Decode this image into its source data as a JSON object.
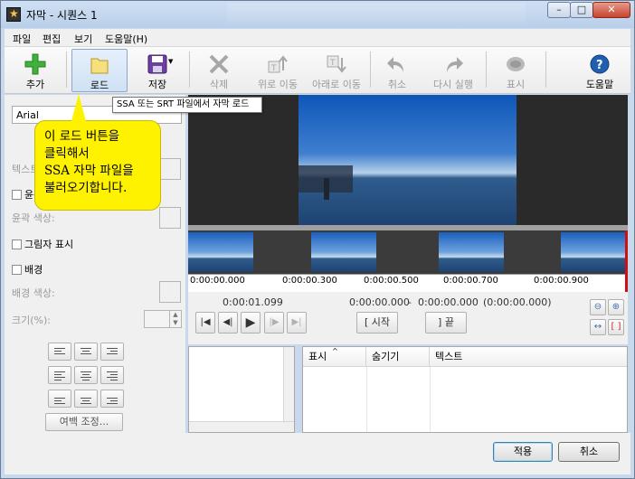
{
  "window": {
    "title": "자막 - 시퀀스 1",
    "controls": [
      "–",
      "□",
      "✕"
    ]
  },
  "menu": [
    "파일",
    "편집",
    "보기",
    "도움말(H)"
  ],
  "toolbar": {
    "add": "추가",
    "load": "로드",
    "save": "저장",
    "delete": "삭제",
    "move_up": "위로 이동",
    "move_down": "아래로 이동",
    "undo": "취소",
    "redo": "다시 실행",
    "show": "표시",
    "help": "도움말"
  },
  "tooltip": "SSA 또는 SRT 파일에서 자막 로드",
  "callout": {
    "line1": "이 로드 버튼을",
    "line2": "클릭해서",
    "line3": "SSA 자막 파일을",
    "line4": "불러오기합니다."
  },
  "properties": {
    "font": "Arial",
    "text_color_label": "텍스트",
    "outline_check": "윤곽",
    "outline_color_label": "윤곽 색상:",
    "shadow_check": "그림자 표시",
    "background_check": "배경",
    "background_color_label": "배경 색상:",
    "size_label": "크기(%):",
    "margin_button": "여백 조정..."
  },
  "timeline": {
    "ticks": [
      "0:00:00.000",
      "0:00:00.300",
      "0:00:00.500",
      "0:00:00.700",
      "0:00:00.900"
    ]
  },
  "transport": {
    "current_time": "0:00:01.099",
    "range_start": "0:00:00.000",
    "dash": "-",
    "range_end": "0:00:00.000",
    "duration": "(0:00:00.000)",
    "start_button": "[ 시작",
    "end_button": "] 끝"
  },
  "subtitle_list": {
    "columns": [
      "표시",
      "숨기기",
      "텍스트"
    ]
  },
  "buttons": {
    "apply": "적용",
    "cancel": "취소"
  }
}
